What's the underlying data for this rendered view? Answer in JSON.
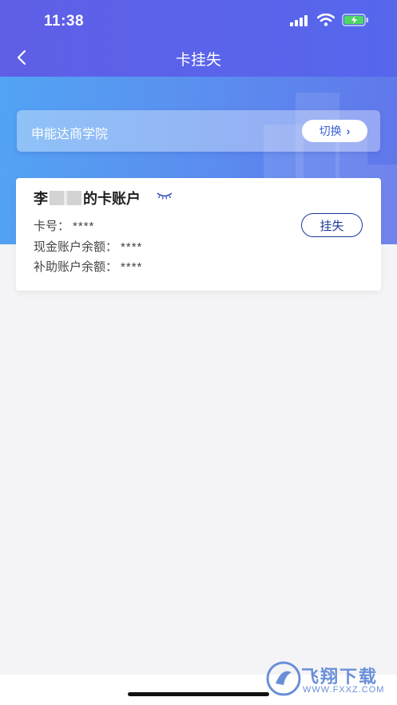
{
  "status_bar": {
    "time": "11:38"
  },
  "nav": {
    "title": "卡挂失"
  },
  "school": {
    "name": "申能达商学院",
    "switch_label": "切换"
  },
  "card": {
    "title_prefix": "李",
    "title_suffix": "的卡账户",
    "card_no_label": "卡号：",
    "card_no_value": "****",
    "cash_label": "现金账户余额：",
    "cash_value": "****",
    "subsidy_label": "补助账户余额：",
    "subsidy_value": "****",
    "report_loss_label": "挂失"
  },
  "watermark": {
    "text": "飞翔下载",
    "url": "WWW.FXXZ.COM"
  },
  "colors": {
    "nav": "#5a63ea",
    "accent": "#1a3a9a",
    "banner": "#52a4f4"
  }
}
